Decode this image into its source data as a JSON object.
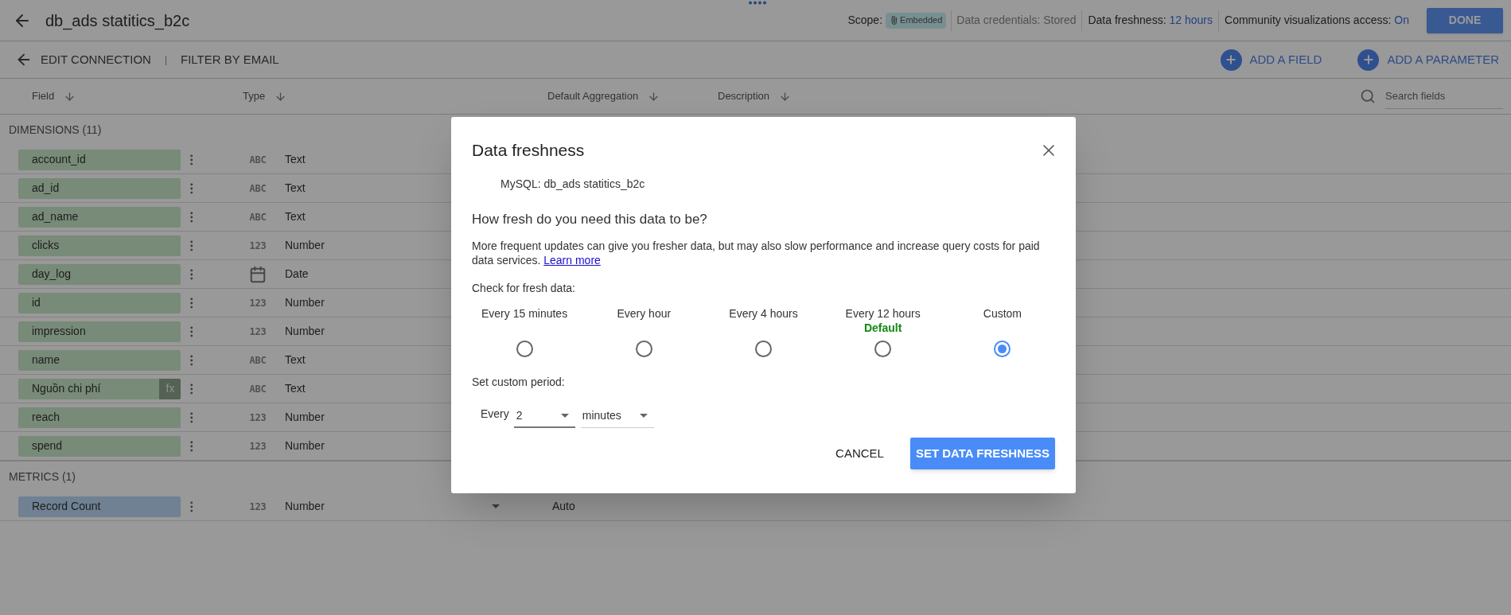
{
  "header": {
    "title": "db_ads statitics_b2c",
    "scope_label": "Scope:",
    "scope_chip": "Embedded",
    "credentials": "Data credentials: Stored",
    "freshness_label": "Data freshness:",
    "freshness_value": "12 hours",
    "community_label": "Community visualizations access:",
    "community_value": "On",
    "done": "DONE"
  },
  "toolbar": {
    "edit_connection": "EDIT CONNECTION",
    "separator": "|",
    "filter": "FILTER BY EMAIL",
    "add_field": "ADD A FIELD",
    "add_parameter": "ADD A PARAMETER"
  },
  "columns": [
    "Field",
    "Type",
    "Default Aggregation",
    "Description"
  ],
  "search": {
    "placeholder": "Search fields"
  },
  "sections": [
    {
      "title": "DIMENSIONS (11)",
      "kind": "dimension",
      "fields": [
        {
          "name": "account_id",
          "kind": "text",
          "type_icon": "ABC",
          "type": "Text"
        },
        {
          "name": "ad_id",
          "kind": "text",
          "type_icon": "ABC",
          "type": "Text"
        },
        {
          "name": "ad_name",
          "kind": "text",
          "type_icon": "ABC",
          "type": "Text"
        },
        {
          "name": "clicks",
          "kind": "number",
          "type_icon": "123",
          "type": "Number"
        },
        {
          "name": "day_log",
          "kind": "date",
          "type": "Date"
        },
        {
          "name": "id",
          "kind": "number",
          "type_icon": "123",
          "type": "Number"
        },
        {
          "name": "impression",
          "kind": "number",
          "type_icon": "123",
          "type": "Number"
        },
        {
          "name": "name",
          "kind": "text",
          "type_icon": "ABC",
          "type": "Text"
        },
        {
          "name": "Nguồn chi phí",
          "kind": "text",
          "type_icon": "ABC",
          "type": "Text",
          "formula_badge": "fx"
        },
        {
          "name": "reach",
          "kind": "number",
          "type_icon": "123",
          "type": "Number"
        },
        {
          "name": "spend",
          "kind": "number",
          "type_icon": "123",
          "type": "Number"
        }
      ]
    },
    {
      "title": "METRICS (1)",
      "kind": "metric",
      "fields": [
        {
          "name": "Record Count",
          "kind": "number",
          "type_icon": "123",
          "type": "Number",
          "aggregation": "Auto"
        }
      ]
    }
  ],
  "dialog": {
    "title": "Data freshness",
    "source": "MySQL: db_ads statitics_b2c",
    "question": "How fresh do you need this data to be?",
    "description": "More frequent updates can give you fresher data, but may also slow performance and increase query costs for paid data services.",
    "link": "Learn more",
    "check_label": "Check for fresh data:",
    "options": [
      {
        "label": "Every 15 minutes",
        "selected": false
      },
      {
        "label": "Every hour",
        "selected": false
      },
      {
        "label": "Every 4 hours",
        "selected": false
      },
      {
        "label": "Every 12 hours",
        "sublabel": "Default",
        "selected": false
      },
      {
        "label": "Custom",
        "selected": true
      }
    ],
    "custom_label": "Set custom period:",
    "every_label": "Every",
    "amount": "2",
    "unit": "minutes",
    "cancel": "CANCEL",
    "submit": "SET DATA FRESHNESS"
  }
}
